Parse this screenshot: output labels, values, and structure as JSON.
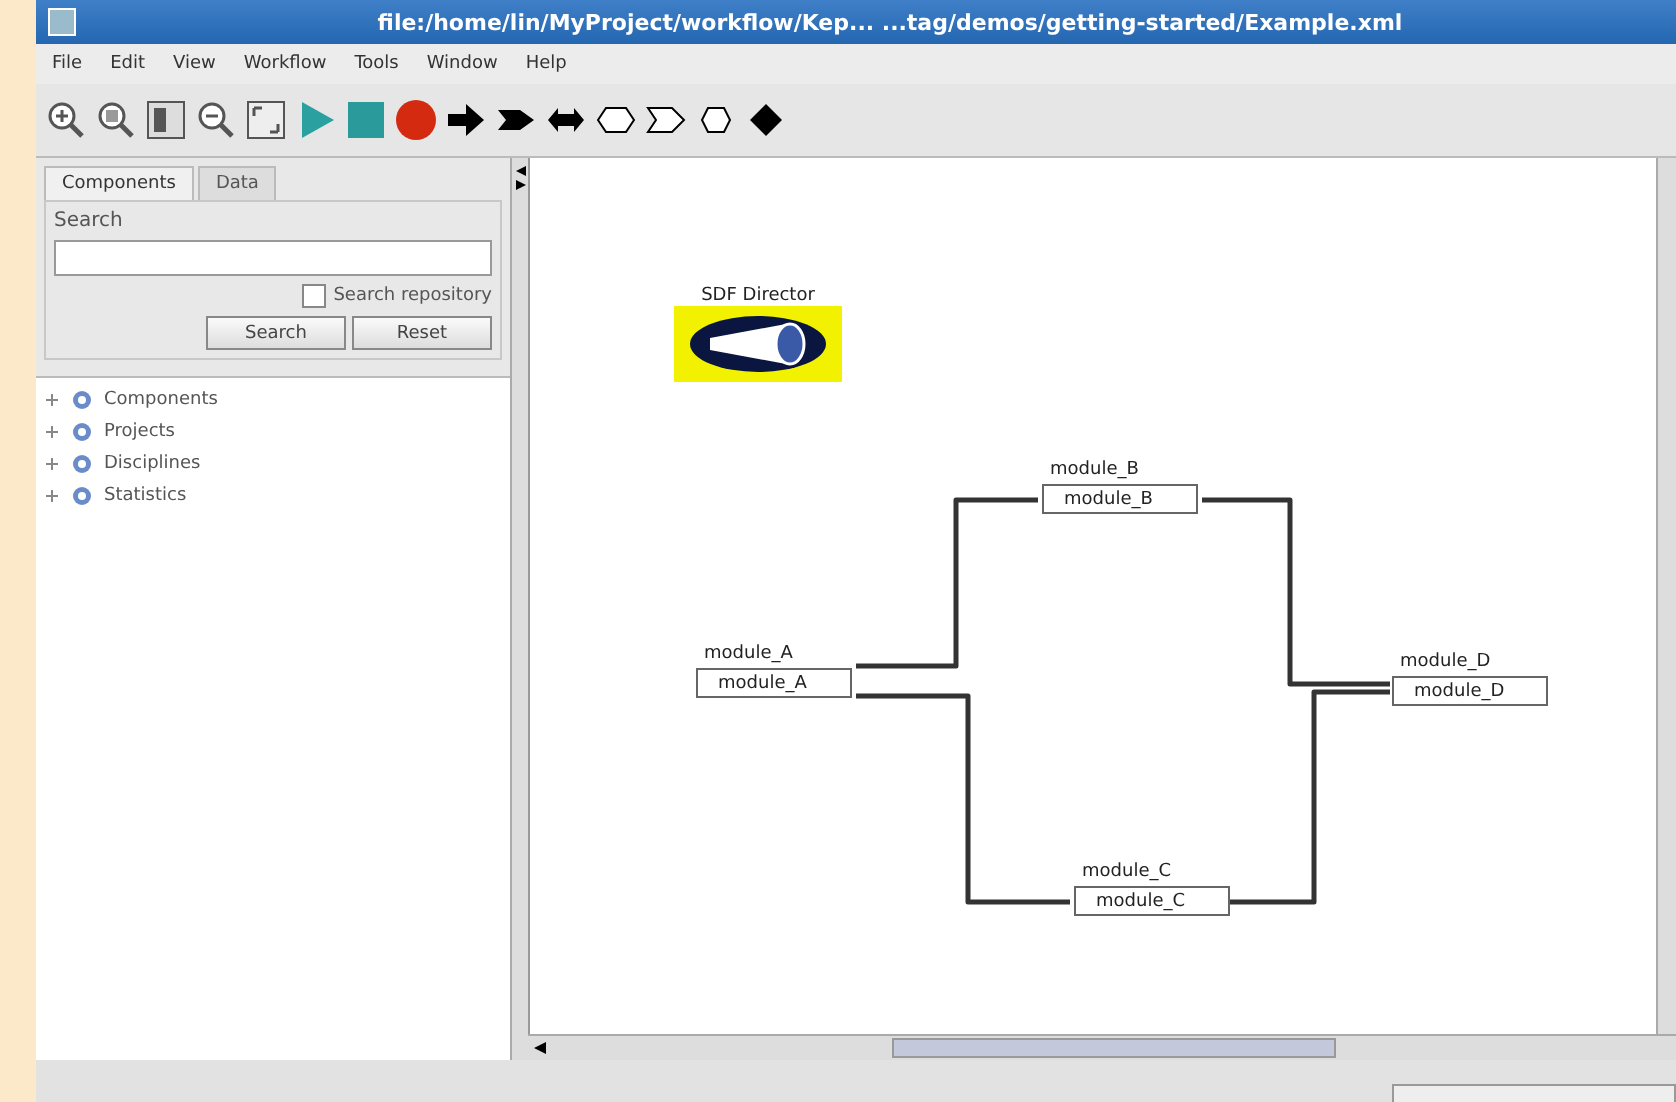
{
  "window": {
    "title": "file:/home/lin/MyProject/workflow/Kep...  ...tag/demos/getting-started/Example.xml"
  },
  "menu": [
    "File",
    "Edit",
    "View",
    "Workflow",
    "Tools",
    "Window",
    "Help"
  ],
  "tabs": [
    {
      "label": "Components",
      "selected": true
    },
    {
      "label": "Data",
      "selected": false
    }
  ],
  "search": {
    "label": "Search",
    "checkbox": {
      "label": "Search repository",
      "checked": false
    },
    "buttons": [
      "Search",
      "Reset"
    ]
  },
  "tree": [
    {
      "label": "Components",
      "expanded": false
    },
    {
      "label": "Projects",
      "expanded": false
    },
    {
      "label": "Disciplines",
      "expanded": false
    },
    {
      "label": "Statistics",
      "expanded": false
    }
  ],
  "canvas": {
    "director": {
      "label": "SDF Director"
    },
    "actors": [
      {
        "label": "module_A",
        "name": "module_A"
      },
      {
        "label": "module_B",
        "name": "module_B"
      },
      {
        "label": "module_C",
        "name": "module_C"
      },
      {
        "label": "module_D",
        "name": "module_D"
      }
    ]
  }
}
